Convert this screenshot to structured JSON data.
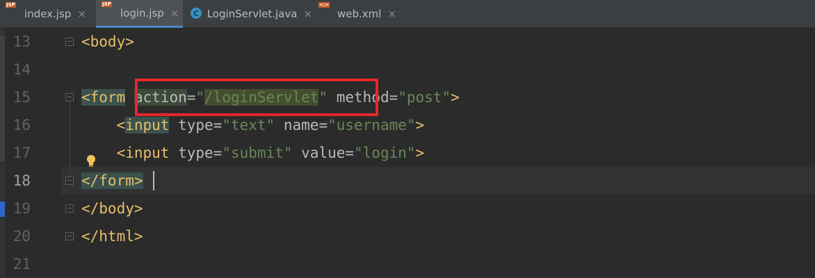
{
  "tabs": [
    {
      "name": "index.jsp",
      "icon": "jsp-file-icon",
      "icon_label": "JSP",
      "active": false
    },
    {
      "name": "login.jsp",
      "icon": "jsp-file-icon",
      "icon_label": "JSP",
      "active": true
    },
    {
      "name": "LoginServlet.java",
      "icon": "java-class-icon",
      "icon_label": "C",
      "active": false
    },
    {
      "name": "web.xml",
      "icon": "xml-file-icon",
      "icon_label": "</>",
      "active": false
    }
  ],
  "close_glyph": "×",
  "line_numbers": [
    "13",
    "14",
    "15",
    "16",
    "17",
    "18",
    "19",
    "20",
    "21"
  ],
  "current_line": "18",
  "code": {
    "l13_tag": "<body>",
    "l15_tag_open": "<form",
    "l15_attr1": "action",
    "l15_eq1": "=",
    "l15_q1": "\"",
    "l15_val1": "/loginServlet",
    "l15_q2": "\"",
    "l15_attr2": "method",
    "l15_eq2": "=",
    "l15_val2": "\"post\"",
    "l15_close": ">",
    "l16_tag_open": "<",
    "l16_tag_name": "input",
    "l16_attr1": "type",
    "l16_val1": "\"text\"",
    "l16_attr2": "name",
    "l16_val2": "\"username\"",
    "l16_close": ">",
    "l17_tag_open": "<input",
    "l17_attr1": "type",
    "l17_val1": "\"submit\"",
    "l17_attr2": "value",
    "l17_val2": "\"login\"",
    "l17_close": ">",
    "l18_tag": "</form>",
    "l19_tag": "</body>",
    "l20_tag": "</html>"
  },
  "colors": {
    "tag": "#e8bf6a",
    "attribute": "#bababa",
    "value": "#6a8759",
    "annotation_box": "#e8262c"
  }
}
